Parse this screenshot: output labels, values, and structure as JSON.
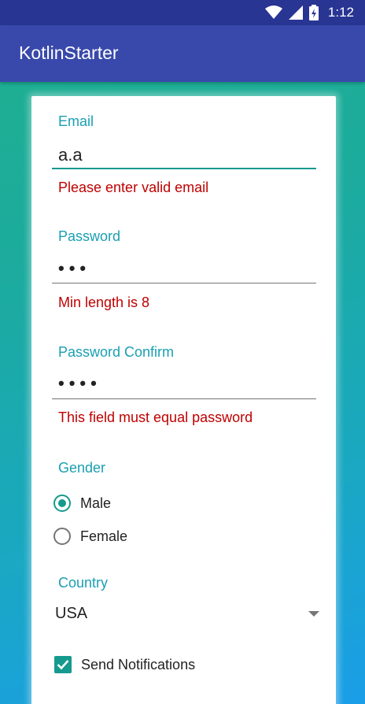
{
  "status_bar": {
    "time": "1:12",
    "icons": [
      "wifi-icon",
      "cell-signal-icon",
      "battery-icon"
    ]
  },
  "app_bar": {
    "title": "KotlinStarter"
  },
  "form": {
    "email": {
      "label": "Email",
      "value": "a.a",
      "error": "Please enter valid email"
    },
    "password": {
      "label": "Password",
      "value": "•••",
      "error": "Min length is 8"
    },
    "password_confirm": {
      "label": "Password Confirm",
      "value": "••••",
      "error": "This field must equal password"
    },
    "gender": {
      "label": "Gender",
      "options": [
        {
          "label": "Male",
          "selected": true
        },
        {
          "label": "Female",
          "selected": false
        }
      ]
    },
    "country": {
      "label": "Country",
      "selected": "USA"
    },
    "notifications": {
      "label": "Send Notifications",
      "checked": true
    }
  },
  "colors": {
    "status_bar": "#283593",
    "app_bar": "#3949ab",
    "accent": "#159a8d",
    "label": "#1a9fb2",
    "error": "#c00000"
  }
}
